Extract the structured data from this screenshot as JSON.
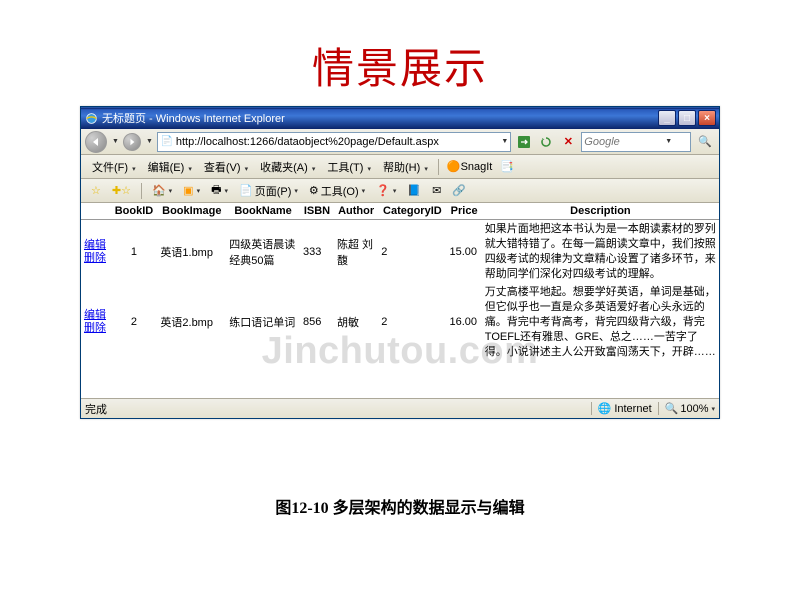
{
  "slideTitle": "情景展示",
  "caption": "图12-10 多层架构的数据显示与编辑",
  "watermark": "Jinchutou.com",
  "window": {
    "title": "无标题页 - Windows Internet Explorer",
    "minimize": "_",
    "maximize": "□",
    "close": "×"
  },
  "address": {
    "url": "http://localhost:1266/dataobject%20page/Default.aspx",
    "goTooltip": "转到",
    "refreshTooltip": "刷新"
  },
  "search": {
    "placeholder": "Google",
    "button": "🔍"
  },
  "menu": {
    "file": "文件(F)",
    "edit": "编辑(E)",
    "view": "查看(V)",
    "favorites": "收藏夹(A)",
    "tools": "工具(T)",
    "help": "帮助(H)",
    "snagit": "SnagIt",
    "snagitWin": "📑"
  },
  "cmd": {
    "favorites": "☆",
    "addFav": "✚",
    "home": "🏠 ▾",
    "feeds": "📡 ▾",
    "print": "🖶 ▾",
    "page": "页面(P)",
    "toolsBtn": "工具(O)",
    "help": "❓ ▾",
    "research": "📘",
    "mail": "✉",
    "other": "🔧"
  },
  "status": {
    "done": "完成",
    "zone": "Internet",
    "zoom": "100%"
  },
  "table": {
    "headers": {
      "ops": "",
      "bookid": "BookID",
      "bookimage": "BookImage",
      "bookname": "BookName",
      "isbn": "ISBN",
      "author": "Author",
      "categoryid": "CategoryID",
      "price": "Price",
      "description": "Description"
    },
    "editLabel": "编辑",
    "deleteLabel": "删除",
    "rows": [
      {
        "bookid": "1",
        "bookimage": "英语1.bmp",
        "bookname": "四级英语晨读经典50篇",
        "isbn": "333",
        "author": "陈超 刘馥",
        "categoryid": "2",
        "price": "15.00",
        "description": "如果片面地把这本书认为是一本朗读素材的罗列就大错特错了。在每一篇朗读文章中，我们按照四级考试的规律为文章精心设置了诸多环节，来帮助同学们深化对四级考试的理解。"
      },
      {
        "bookid": "2",
        "bookimage": "英语2.bmp",
        "bookname": "练口语记单词",
        "isbn": "856",
        "author": "胡敏",
        "categoryid": "2",
        "price": "16.00",
        "description": "万丈高楼平地起。想要学好英语，单词是基础，但它似乎也一直是众多英语爱好者心头永远的痛。背完中考背高考，背完四级背六级，背完TOEFL还有雅思、GRE、总之……一苦字了得。小说讲述主人公开致富闯荡天下，开辟……"
      }
    ]
  }
}
